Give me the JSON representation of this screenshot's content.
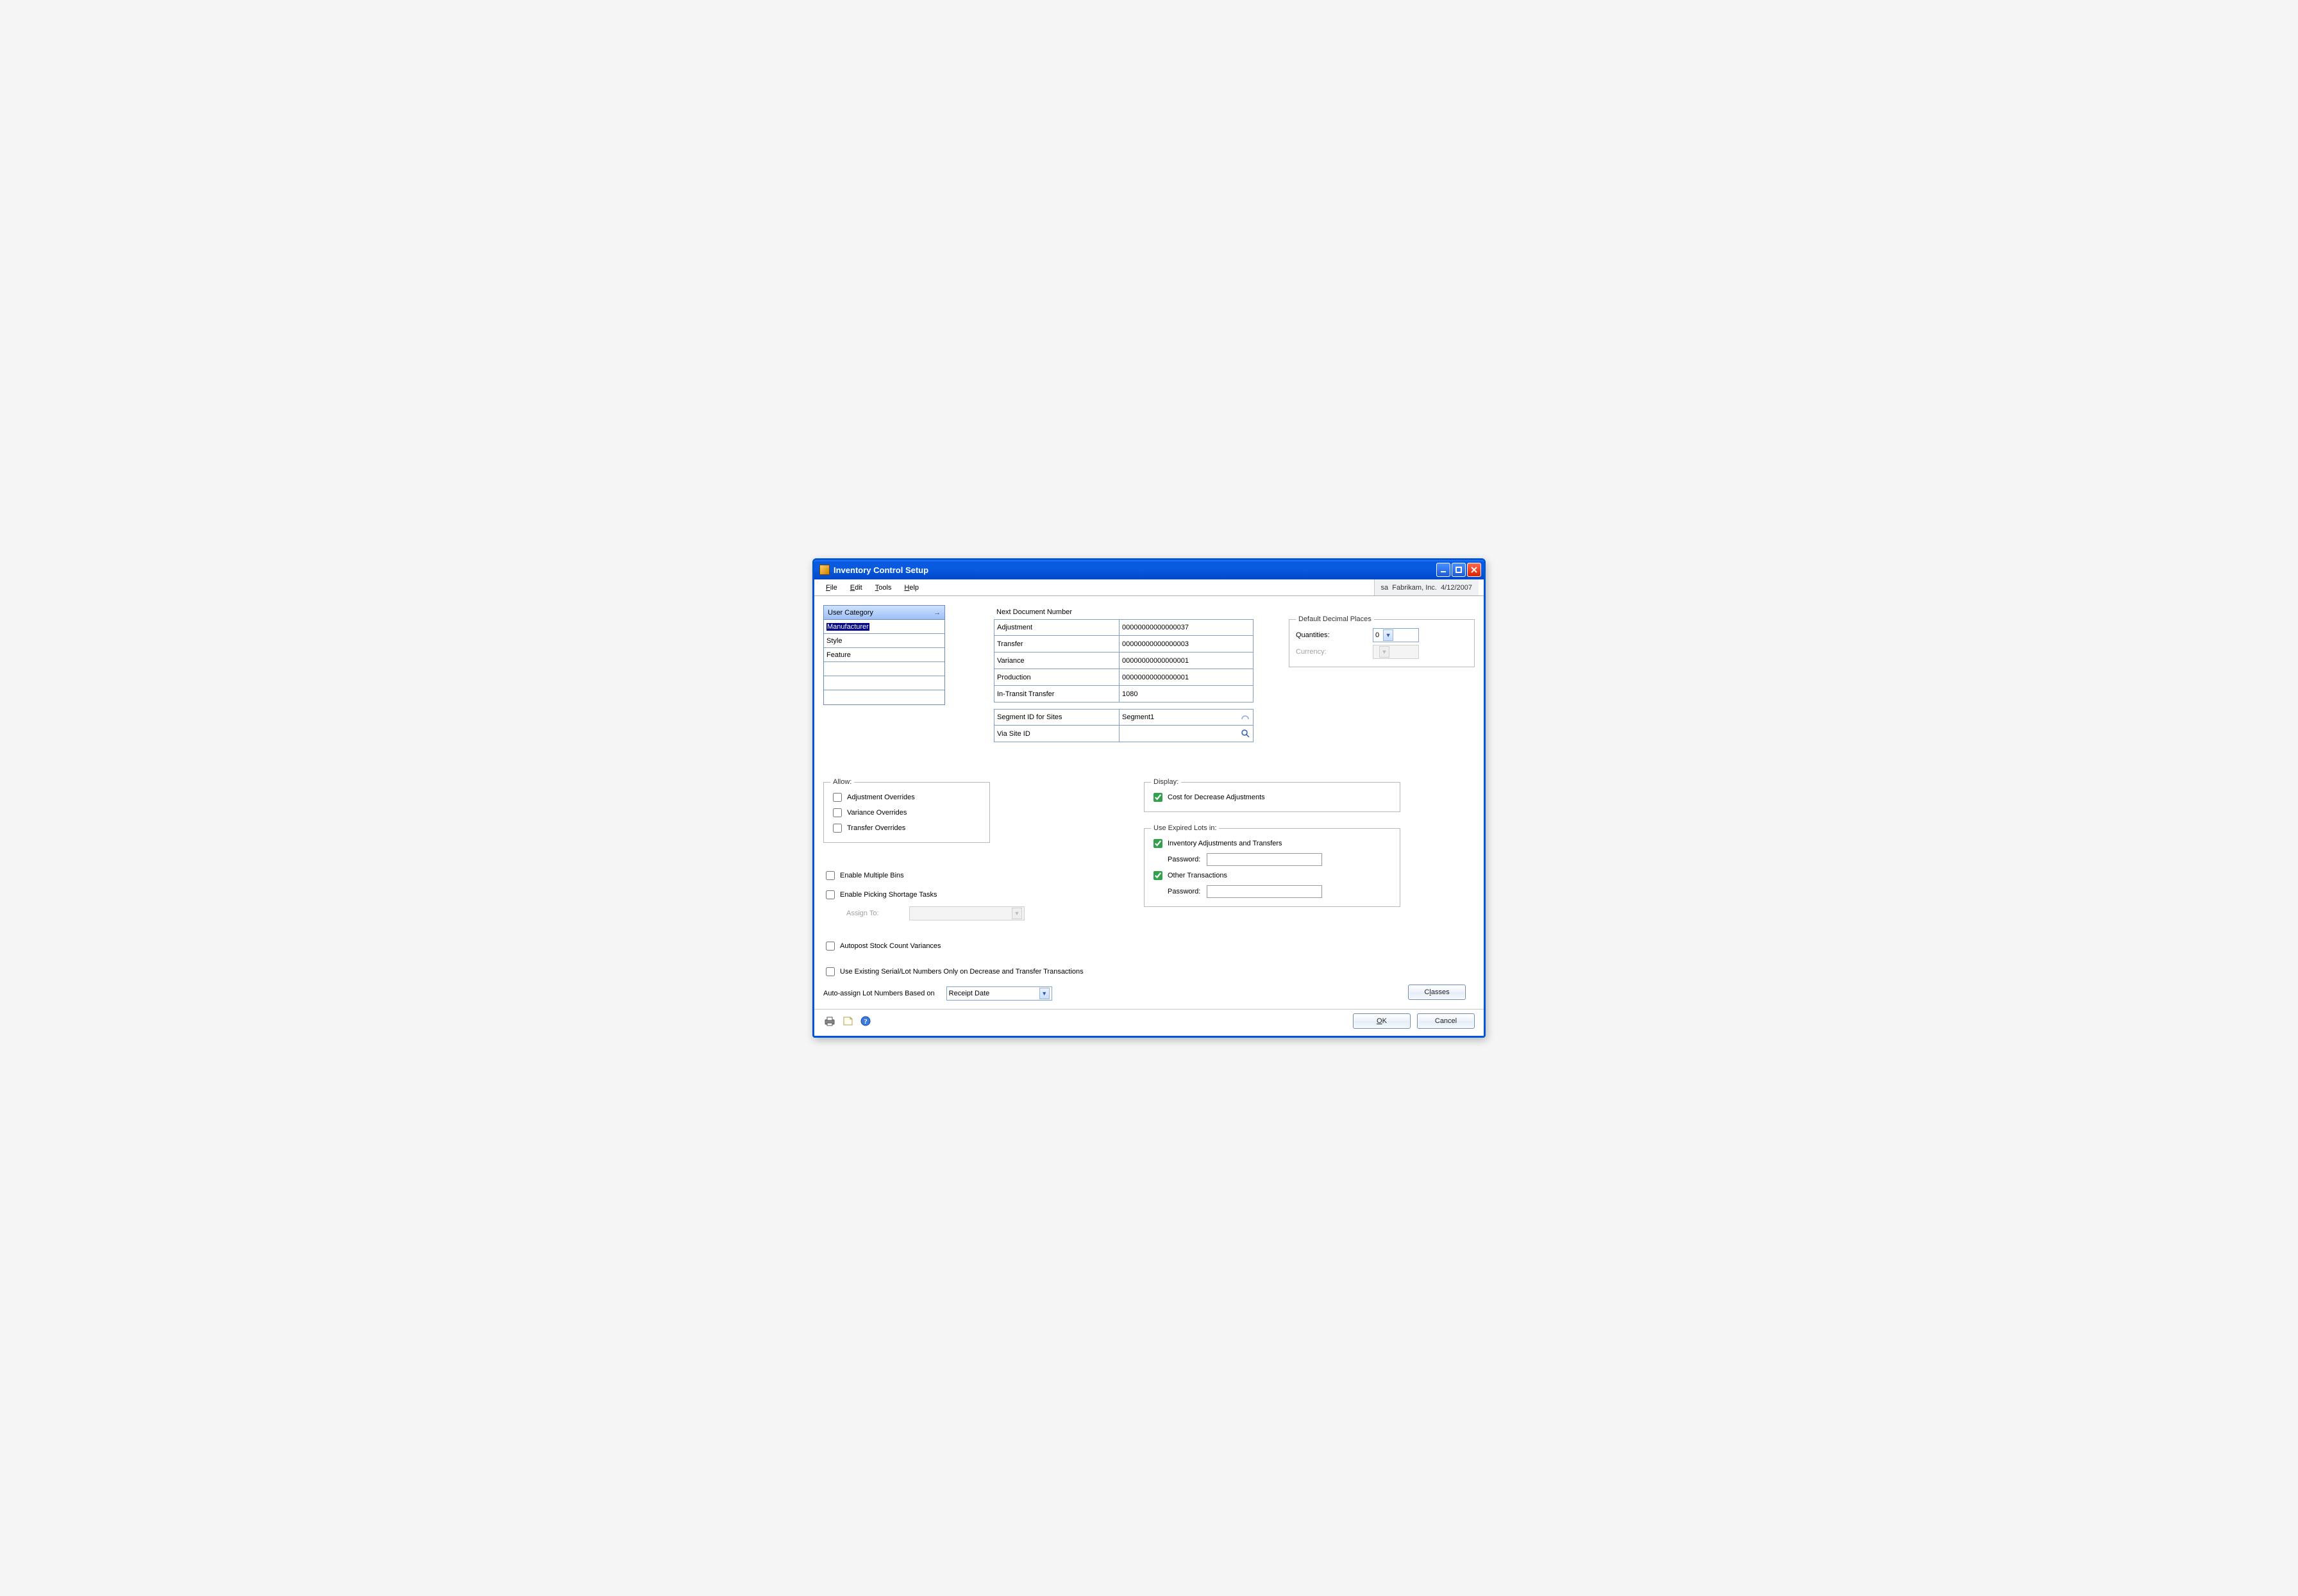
{
  "window": {
    "title": "Inventory Control Setup"
  },
  "menus": {
    "file": "File",
    "edit": "Edit",
    "tools": "Tools",
    "help": "Help"
  },
  "status": {
    "user": "sa",
    "company": "Fabrikam, Inc.",
    "date": "4/12/2007"
  },
  "user_category": {
    "header": "User Category",
    "rows": [
      "Manufacturer",
      "Style",
      "Feature",
      "",
      "",
      ""
    ]
  },
  "ndn": {
    "header": "Next Document Number",
    "rows": {
      "adjustment_label": "Adjustment",
      "adjustment_value": "00000000000000037",
      "transfer_label": "Transfer",
      "transfer_value": "00000000000000003",
      "variance_label": "Variance",
      "variance_value": "00000000000000001",
      "production_label": "Production",
      "production_value": "00000000000000001",
      "intransit_label": "In-Transit Transfer",
      "intransit_value": "1080"
    },
    "segment_label": "Segment ID for Sites",
    "segment_value": "Segment1",
    "viasite_label": "Via Site ID",
    "viasite_value": ""
  },
  "defaults": {
    "legend": "Default Decimal Places",
    "quantities_label": "Quantities:",
    "quantities_value": "0",
    "currency_label": "Currency:"
  },
  "allow": {
    "legend": "Allow:",
    "adj": "Adjustment Overrides",
    "var": "Variance Overrides",
    "trn": "Transfer Overrides"
  },
  "cbs": {
    "multibins": "Enable Multiple Bins",
    "picking": "Enable Picking Shortage Tasks",
    "assignto": "Assign To:",
    "autopost": "Autopost Stock Count Variances",
    "serial": "Use Existing Serial/Lot Numbers Only on Decrease and Transfer Transactions"
  },
  "display": {
    "legend": "Display:",
    "costdecr": "Cost for Decrease Adjustments"
  },
  "uel": {
    "legend": "Use Expired Lots in:",
    "inv": "Inventory Adjustments and Transfers",
    "other": "Other Transactions",
    "pwd": "Password:"
  },
  "autolot": {
    "label": "Auto-assign Lot Numbers Based on",
    "value": "Receipt Date"
  },
  "buttons": {
    "classes": "Classes",
    "ok": "OK",
    "cancel": "Cancel"
  }
}
